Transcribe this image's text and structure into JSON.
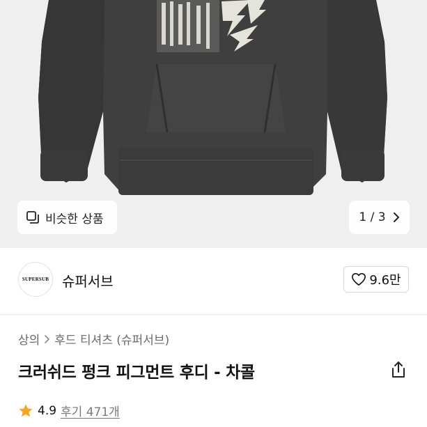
{
  "product_image": {
    "similar_label": "비슷한 상품",
    "pager": "1 / 3"
  },
  "brand": {
    "logo_text": "SUPERSUB",
    "name": "슈퍼서브",
    "likes": "9.6만"
  },
  "breadcrumb": {
    "items": [
      "상의",
      "후드 티셔츠 (슈퍼서브)"
    ]
  },
  "product": {
    "title": "크러쉬드 펑크 피그먼트 후디 - 차콜"
  },
  "rating": {
    "score": "4.9",
    "reviews": "후기 471개"
  },
  "colors": {
    "hoodie": "#3e3e3e",
    "star": "#f5a623",
    "background": "#efefef"
  }
}
